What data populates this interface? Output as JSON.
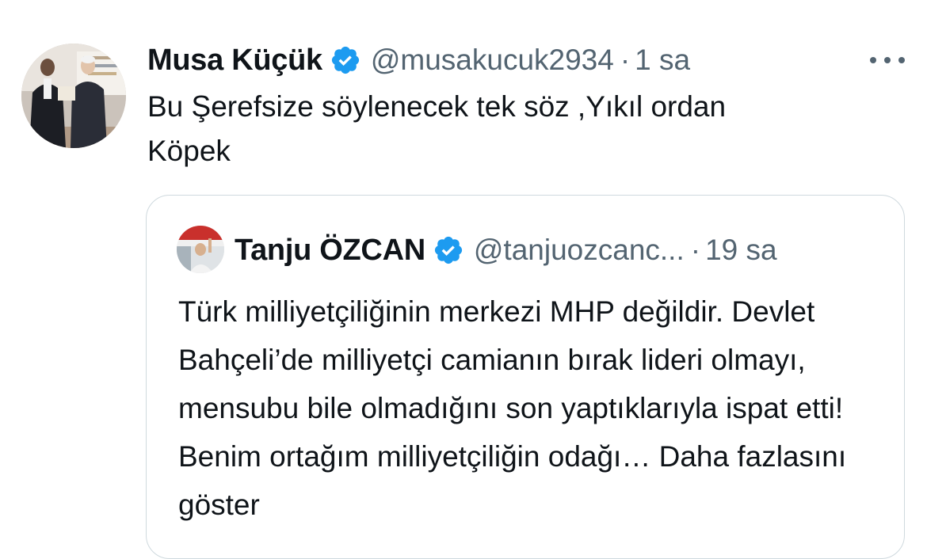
{
  "tweet": {
    "author_name": "Musa Küçük",
    "handle": "@musakucuk2934",
    "separator": "·",
    "time": "1 sa",
    "text": "Bu Şerefsize söylenecek tek söz ,Yıkıl ordan\nKöpek",
    "verified": true
  },
  "quoted_tweet": {
    "author_name": "Tanju ÖZCAN",
    "handle": "@tanjuozcanc...",
    "separator": "·",
    "time": "19 sa",
    "text": "Türk milliyetçiliğinin merkezi MHP değildir. Devlet Bahçeli’de milliyetçi camianın bırak lideri olmayı, mensubu bile olmadığını son yaptıklarıyla ispat etti! Benim ortağım milliyetçiliğin odağı…",
    "show_more": "Daha fazlasını göster",
    "verified": true
  },
  "colors": {
    "text": "#0f1419",
    "muted": "#536471",
    "verified_blue": "#1d9bf0",
    "border": "#cfd9de",
    "link": "#0f1419"
  },
  "icons": {
    "verified": "verified-badge-icon",
    "more": "more-options-icon"
  }
}
